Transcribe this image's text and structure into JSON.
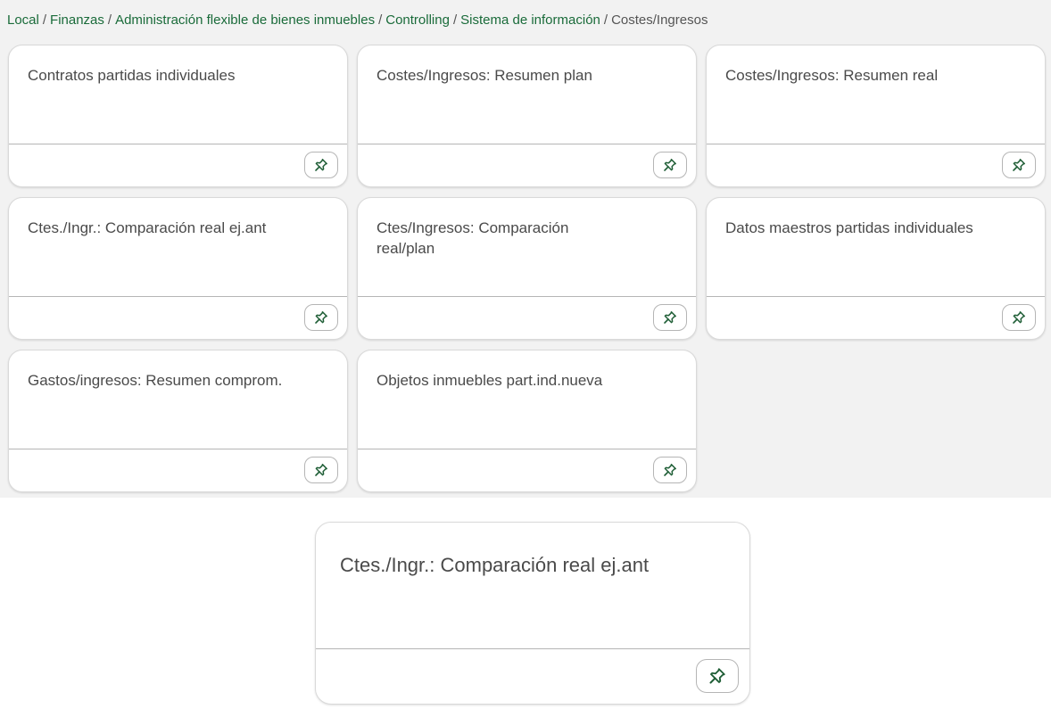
{
  "breadcrumb": {
    "items": [
      "Local",
      "Finanzas",
      "Administración flexible de bienes inmuebles",
      "Controlling",
      "Sistema de información"
    ],
    "current": "Costes/Ingresos",
    "separator": "/"
  },
  "tiles": [
    {
      "title": "Contratos partidas individuales"
    },
    {
      "title": "Costes/Ingresos: Resumen plan"
    },
    {
      "title": "Costes/Ingresos: Resumen real"
    },
    {
      "title": "Ctes./Ingr.: Comparación real ej.ant"
    },
    {
      "title": "Ctes/Ingresos: Comparación real/plan"
    },
    {
      "title": "Datos maestros partidas individuales"
    },
    {
      "title": "Gastos/ingresos: Resumen comprom."
    },
    {
      "title": "Objetos inmuebles part.ind.nueva"
    }
  ],
  "zoomed_tile": {
    "title": "Ctes./Ingr.: Comparación real ej.ant"
  },
  "icons": {
    "pin": "pin-icon"
  },
  "colors": {
    "link": "#1a6b3a",
    "pin": "#1f5e36",
    "panel_bg": "#f2f2f2"
  }
}
